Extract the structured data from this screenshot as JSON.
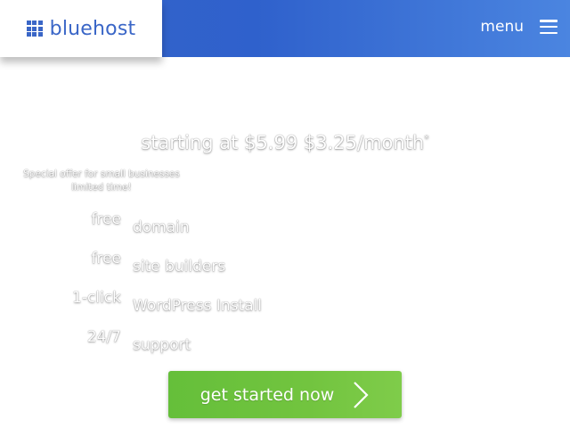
{
  "header": {
    "brand": "bluehost",
    "menu_label": "menu",
    "colors": {
      "bar": "#3563c8",
      "logo": "#3a66c7"
    }
  },
  "hero": {
    "price_text": "starting at $5.99 $3.25/month",
    "price_note_mark": "*",
    "offer_line1": "Special offer for small businesses",
    "offer_line2": "limited time!"
  },
  "features": [
    {
      "label": "free",
      "value": "domain"
    },
    {
      "label": "free",
      "value": "site builders"
    },
    {
      "label": "1-click",
      "value": "WordPress Install"
    },
    {
      "label": "24/7",
      "value": "support"
    }
  ],
  "cta": {
    "label": "get started now",
    "icon": "chevron-right-icon",
    "color": "#6cc23d"
  }
}
